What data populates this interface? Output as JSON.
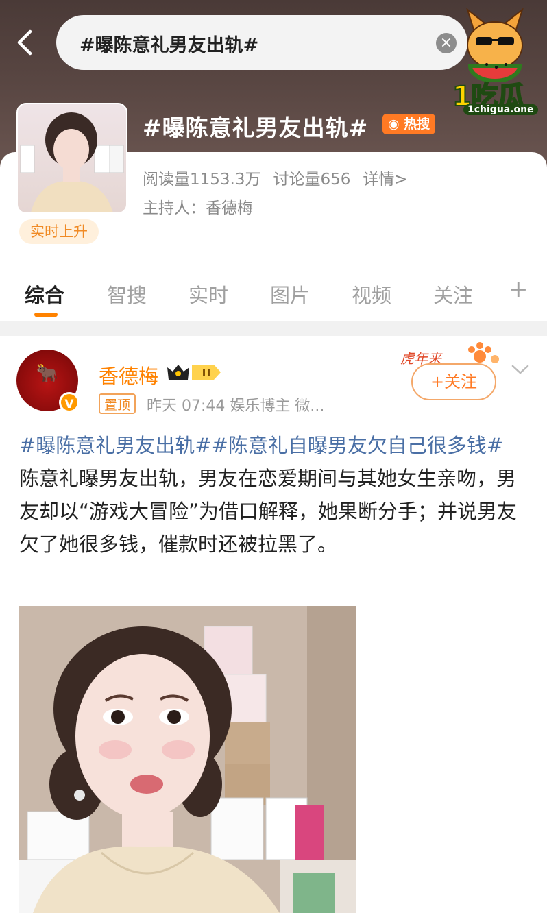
{
  "search": {
    "query": "#曝陈意礼男友出轨#",
    "clear_icon": "close-icon"
  },
  "watermark": {
    "brand": "1吃瓜",
    "url": "1chigua.one"
  },
  "topic": {
    "title": "#曝陈意礼男友出轨#",
    "hot_label": "热搜",
    "reads": "阅读量1153.3万",
    "discussions": "讨论量656",
    "details": "详情>",
    "host": "主持人：香德梅",
    "rising_badge": "实时上升"
  },
  "tabs": [
    {
      "label": "综合",
      "active": true
    },
    {
      "label": "智搜"
    },
    {
      "label": "实时"
    },
    {
      "label": "图片"
    },
    {
      "label": "视频"
    },
    {
      "label": "关注"
    },
    {
      "label": "+"
    }
  ],
  "post": {
    "author": "香德梅",
    "level": "II",
    "pinned": "置顶",
    "meta": "昨天 07:44  娱乐博主 微...",
    "follow_label": "+关注",
    "deco_text": "虎年来",
    "tag1": "#曝陈意礼男友出轨#",
    "tag2": "#陈意礼自曝男友欠自己很多钱#",
    "body": " 陈意礼曝男友出轨，男友在恋爱期间与其她女生亲吻，男友却以“游戏大冒险”为借口解释，她果断分手；并说男友欠了她很多钱，催款时还被拉黑了。"
  },
  "colors": {
    "accent": "#ff8200",
    "tag": "#4a6fa5",
    "hot": "#ff7a24"
  }
}
